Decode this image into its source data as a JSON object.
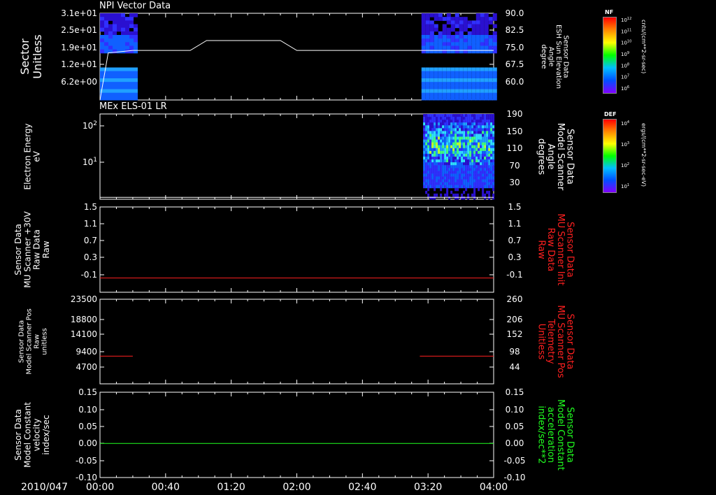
{
  "page": {
    "date_label": "2010/047"
  },
  "time_ticks": [
    "00:00",
    "00:40",
    "01:20",
    "02:00",
    "02:40",
    "03:20",
    "04:00"
  ],
  "colors": {
    "white": "#ffffff",
    "red": "#ff2020",
    "green": "#20ff20"
  },
  "panels": [
    {
      "id": "npi",
      "title": "NPI Vector Data",
      "left_label": [
        "Sector",
        "Unitless"
      ],
      "right_label": [
        "Sensor Data",
        "ESH Sun Elevation",
        "Angle",
        "degree"
      ],
      "left_ticks": [
        "3.1e+01",
        "2.5e+01",
        "1.9e+01",
        "1.2e+01",
        "6.2e+00"
      ],
      "right_ticks": [
        "90.0",
        "82.5",
        "75.0",
        "67.5",
        "60.0"
      ],
      "colorbar": {
        "label": "NF",
        "units": "cnts/(cm**2-sr-sec)",
        "ticks": [
          "10^12",
          "10^11",
          "10^10",
          "10^9",
          "10^8",
          "10^7",
          "10^6"
        ]
      }
    },
    {
      "id": "els",
      "title": "MEx ELS-01 LR",
      "left_label": [
        "Electron Energy",
        "eV"
      ],
      "right_label": [
        "Sensor Data",
        "Model Scanner",
        "Angle",
        "degrees"
      ],
      "left_ticks": [
        "10^2",
        "10^1"
      ],
      "right_ticks": [
        "190",
        "150",
        "110",
        "70",
        "30"
      ],
      "colorbar": {
        "label": "DEF",
        "units": "ergs/(cm**2-sr-sec-eV)",
        "ticks": [
          "10^4",
          "10^3",
          "10^2",
          "10^1"
        ]
      }
    },
    {
      "id": "mu-raw",
      "title": "",
      "left_label": [
        "Sensor Data",
        "MU Scanner +30V",
        "Raw Data",
        "Raw"
      ],
      "right_label": [
        "Sensor Data",
        "MU Scanner Init",
        "Raw Data",
        "Raw"
      ],
      "left_ticks": [
        "1.5",
        "1.1",
        "0.7",
        "0.3",
        "-0.1"
      ],
      "right_ticks": [
        "1.5",
        "1.1",
        "0.7",
        "0.3",
        "-0.1"
      ]
    },
    {
      "id": "scanner-pos",
      "title": "",
      "left_label": [
        "Sensor Data",
        "Model Scanner Pos",
        "Raw",
        "unitless"
      ],
      "right_label": [
        "Sensor Data",
        "MU Scanner Pos",
        "Telemetry",
        "Unitless"
      ],
      "left_ticks": [
        "23500",
        "18800",
        "14100",
        "9400",
        "4700"
      ],
      "right_ticks": [
        "260",
        "206",
        "152",
        "98",
        "44"
      ]
    },
    {
      "id": "velocity",
      "title": "",
      "left_label": [
        "Sensor Data",
        "Model Constant",
        "velocity",
        "index/sec"
      ],
      "right_label": [
        "Sensor Data",
        "Model Constant",
        "acceleration",
        "index/sec**2"
      ],
      "left_ticks": [
        "0.15",
        "0.10",
        "0.05",
        "0.00",
        "-0.05",
        "-0.10"
      ],
      "right_ticks": [
        "0.15",
        "0.10",
        "0.05",
        "0.00",
        "-0.05",
        "-0.10"
      ]
    }
  ],
  "chart_data": [
    {
      "type": "heatmap",
      "title": "NPI Vector Data",
      "ylabel": "Sector Unitless",
      "x_range": [
        "00:00",
        "04:00"
      ],
      "data_coverage": [
        [
          "00:00",
          "00:23"
        ],
        [
          "03:16",
          "04:00"
        ]
      ],
      "overlay_line": {
        "axis": "right",
        "ylim": [
          55,
          90
        ],
        "x": [
          "00:00",
          "00:05",
          "00:20",
          "00:55",
          "01:05",
          "01:50",
          "02:00",
          "03:20",
          "04:00"
        ],
        "y": [
          55,
          74,
          75,
          75,
          79,
          79,
          75,
          75,
          75
        ]
      }
    },
    {
      "type": "heatmap",
      "title": "MEx ELS-01 LR",
      "ylabel": "Electron Energy eV",
      "yscale": "log",
      "x_range": [
        "00:00",
        "04:00"
      ],
      "data_coverage": [
        [
          "03:17",
          "04:00"
        ]
      ],
      "overlay_line": {
        "axis": "right",
        "ylim": [
          10,
          190
        ],
        "x": [
          "00:00",
          "04:00"
        ],
        "y": [
          14,
          14
        ]
      }
    },
    {
      "type": "line",
      "ylabel": "Sensor Data MU Scanner +30V Raw Data Raw",
      "ylim": [
        -0.3,
        1.5
      ],
      "series": [
        {
          "x": [
            "00:00",
            "04:00"
          ],
          "y": [
            0.0,
            0.0
          ],
          "axis": "right"
        }
      ]
    },
    {
      "type": "line",
      "ylabel": "Sensor Data Model Scanner Pos Raw unitless",
      "ylim": [
        0,
        23500
      ],
      "series": [
        {
          "x": [
            "00:00",
            "00:20"
          ],
          "y": [
            7700,
            7700
          ],
          "axis": "left"
        },
        {
          "x": [
            "03:15",
            "04:00"
          ],
          "y": [
            7700,
            7700
          ],
          "axis": "left"
        }
      ]
    },
    {
      "type": "line",
      "ylabel": "Sensor Data Model Constant velocity index/sec",
      "ylim": [
        -0.1,
        0.15
      ],
      "series": [
        {
          "x": [
            "00:00",
            "04:00"
          ],
          "y": [
            0.0,
            0.0
          ],
          "axis": "left"
        }
      ]
    }
  ]
}
